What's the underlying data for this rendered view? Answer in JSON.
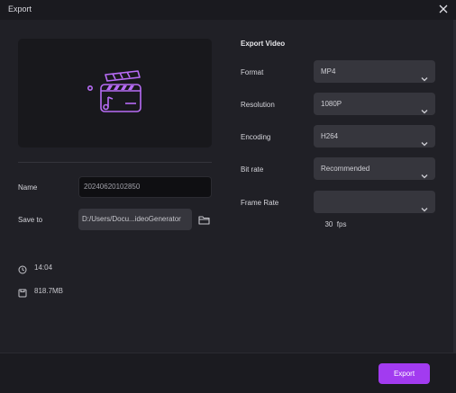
{
  "window": {
    "title": "Export"
  },
  "colors": {
    "accent": "#a23bf0",
    "preview_icon": "#b76cf5",
    "background": "#202026"
  },
  "icons": {
    "close": "close-icon",
    "preview": "clapperboard-music-icon",
    "folder": "folder-icon",
    "duration": "clock-icon",
    "size": "storage-icon",
    "dropdown": "chevron-down-icon"
  },
  "left": {
    "name_label": "Name",
    "name_value": "20240620102850",
    "save_label": "Save to",
    "save_path": "D:/Users/Docu...ideoGenerator",
    "duration": "14:04",
    "file_size": "818.7MB"
  },
  "export_settings": {
    "title": "Export Video",
    "format": {
      "label": "Format",
      "value": "MP4"
    },
    "resolution": {
      "label": "Resolution",
      "value": "1080P"
    },
    "encoding": {
      "label": "Encoding",
      "value": "H264"
    },
    "bitrate": {
      "label": "Bit rate",
      "value": "Recommended"
    },
    "framerate": {
      "label": "Frame Rate",
      "value": "30  fps"
    }
  },
  "footer": {
    "export_label": "Export"
  }
}
